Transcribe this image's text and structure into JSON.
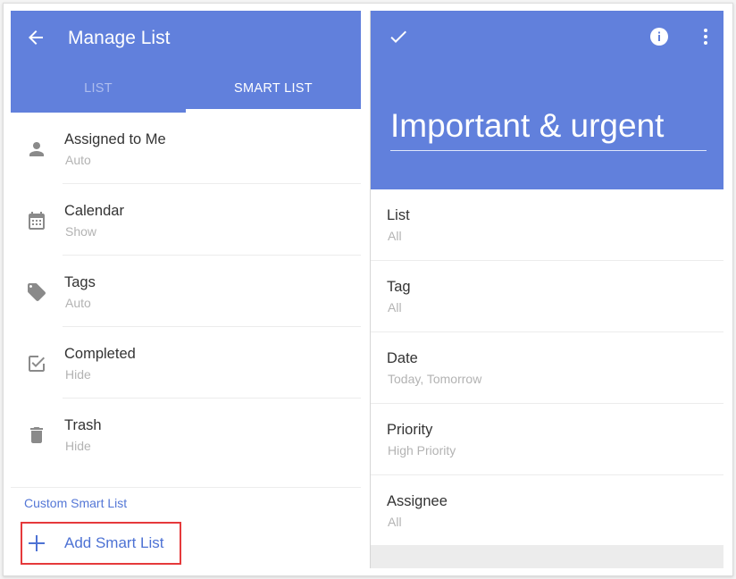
{
  "colors": {
    "primary": "#6180dc",
    "accent_text": "#4d72d4",
    "highlight_border": "#e5393b"
  },
  "left": {
    "title": "Manage List",
    "back_icon": "arrow-back-icon",
    "tabs": [
      {
        "label": "LIST",
        "active": false
      },
      {
        "label": "SMART LIST",
        "active": true
      }
    ],
    "items": [
      {
        "label": "Assigned to Me",
        "value": "Auto",
        "icon": "person-icon"
      },
      {
        "label": "Calendar",
        "value": "Show",
        "icon": "calendar-icon"
      },
      {
        "label": "Tags",
        "value": "Auto",
        "icon": "tag-icon"
      },
      {
        "label": "Completed",
        "value": "Hide",
        "icon": "checkbox-icon"
      },
      {
        "label": "Trash",
        "value": "Hide",
        "icon": "trash-icon"
      }
    ],
    "custom_section_label": "Custom Smart List",
    "add_button_label": "Add Smart List"
  },
  "right": {
    "list_name": "Important & urgent",
    "properties": [
      {
        "label": "List",
        "value": "All"
      },
      {
        "label": "Tag",
        "value": "All"
      },
      {
        "label": "Date",
        "value": "Today, Tomorrow"
      },
      {
        "label": "Priority",
        "value": "High Priority"
      },
      {
        "label": "Assignee",
        "value": "All"
      }
    ]
  }
}
